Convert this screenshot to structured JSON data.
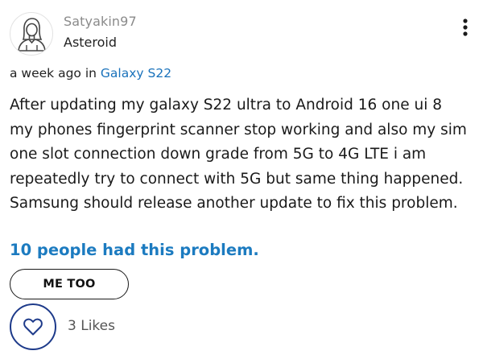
{
  "author": {
    "username": "Satyakin97",
    "rank": "Asteroid",
    "avatar_icon": "person-avatar-icon"
  },
  "post": {
    "posted_time": "a week ago",
    "in_label": "in",
    "board_name": "Galaxy S22",
    "body": "After updating my galaxy S22 ultra to Android 16 one ui 8 my phones fingerprint scanner stop working and also my sim one slot connection down grade from 5G to 4G LTE i am repeatedly try to connect with 5G but same thing happened. Samsung should release another update to fix this problem."
  },
  "problem": {
    "count_text": "10 people had this problem.",
    "me_too_label": "ME TOO"
  },
  "likes": {
    "count_text": "3 Likes",
    "icon": "heart-icon"
  },
  "menu": {
    "icon": "more-vertical-icon"
  },
  "colors": {
    "link": "#1a72bb",
    "problem_text": "#1c7bc0",
    "like_ring": "#1d3a8a",
    "muted_text": "#8a8a8a"
  }
}
